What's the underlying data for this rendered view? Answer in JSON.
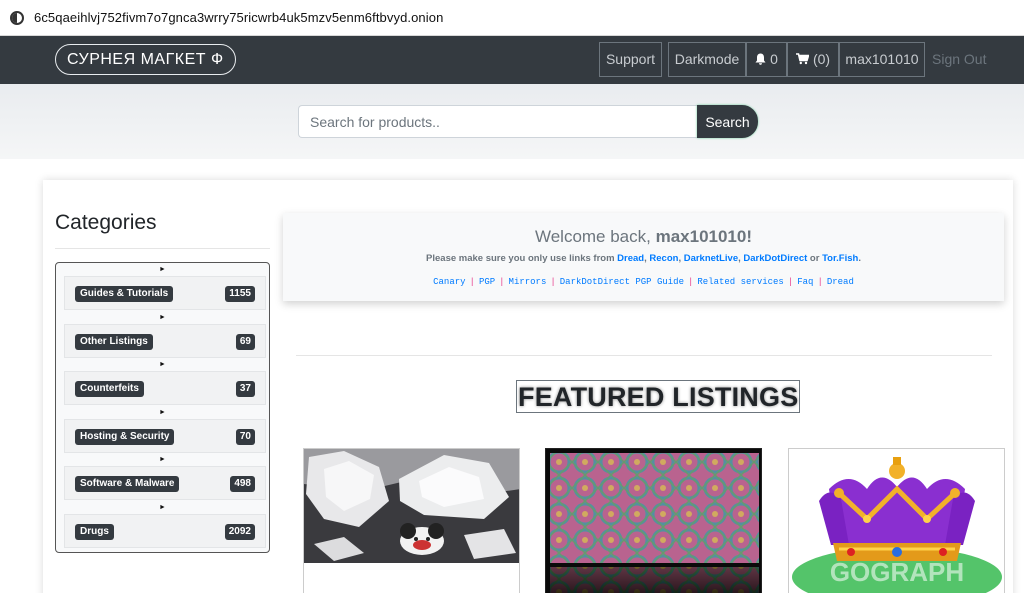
{
  "browser": {
    "url": "6c5qaeihlvj752fivm7o7gnca3wrry75ricwrb4uk5mzv5enm6ftbvyd.onion"
  },
  "navbar": {
    "brand": "СУРНЕЯ МАГКЕТ Ф",
    "support": "Support",
    "darkmode": "Darkmode",
    "notifications_count": "0",
    "cart_count": "(0)",
    "username": "max101010",
    "signout": "Sign Out"
  },
  "search": {
    "placeholder": "Search for products..",
    "button": "Search"
  },
  "sidebar": {
    "title": "Categories",
    "items": [
      {
        "label": "Guides & Tutorials",
        "count": "1155"
      },
      {
        "label": "Other Listings",
        "count": "69"
      },
      {
        "label": "Counterfeits",
        "count": "37"
      },
      {
        "label": "Hosting & Security",
        "count": "70"
      },
      {
        "label": "Software & Malware",
        "count": "498"
      },
      {
        "label": "Drugs",
        "count": "2092"
      }
    ],
    "expand_glyph": "►"
  },
  "welcome": {
    "prefix": "Welcome back, ",
    "user": "max101010!",
    "note_prefix": "Please make sure you only use links from ",
    "note_links": [
      "Dread",
      "Recon",
      "DarknetLive",
      "DarkDotDirect"
    ],
    "note_or": " or ",
    "note_last": "Tor.Fish",
    "links": [
      "Canary",
      "PGP",
      "Mirrors",
      "DarkDotDirect PGP Guide",
      "Related services",
      "Faq",
      "Dread"
    ],
    "link_separator": "|"
  },
  "featured": {
    "title": "FEATURED LISTINGS",
    "listing_3_watermark": "GOGRAPH"
  },
  "icons": {
    "browser": "onion-icon",
    "notifications": "bell-icon",
    "cart": "cart-icon"
  }
}
